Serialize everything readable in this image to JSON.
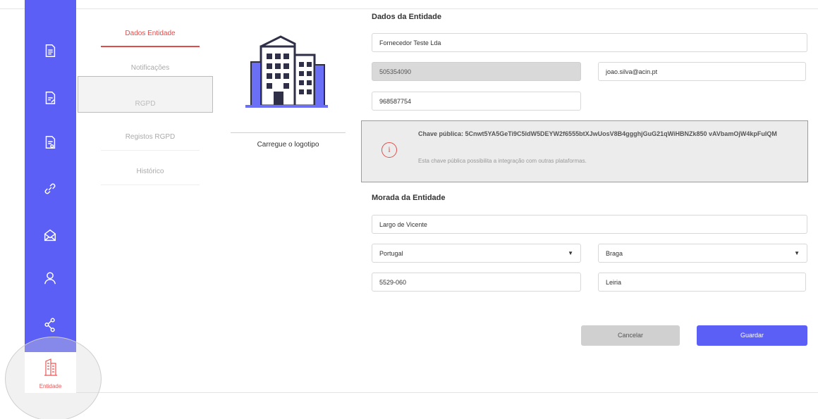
{
  "sidebar": {
    "icons": [
      "document-icon",
      "document-edit-icon",
      "document-check-icon",
      "link-icon",
      "mail-icon",
      "user-icon",
      "share-icon"
    ],
    "active_label": "Entidade",
    "active_icon": "building-icon"
  },
  "tabs": [
    "Dados Entidade",
    "Notificações",
    "RGPD",
    "Registos RGPD",
    "Histórico"
  ],
  "logo": {
    "caption": "Carregue o logotipo"
  },
  "entity": {
    "title": "Dados da Entidade",
    "name": "Fornecedor Teste Lda",
    "nif": "505354090",
    "email": "joao.silva@acin.pt",
    "phone": "968587754"
  },
  "key_info": {
    "key_text": "Chave pública: 5Cnwt5YA5GeTi9C5ldW5DEYW2f6555btXJwUosV8B4ggghjGuG21qWiHBNZk850 vAVbamOjW4kpFuIQM",
    "description": "Esta chave pública possibilita a integração com outras plataformas."
  },
  "address": {
    "title": "Morada da Entidade",
    "street": "Largo de Vicente",
    "country": "Portugal",
    "district": "Braga",
    "postal_code": "5529-060",
    "city": "Leiria"
  },
  "buttons": {
    "cancel": "Cancelar",
    "save": "Guardar"
  },
  "colors": {
    "primary": "#5b5ff5",
    "accent": "#e24b4b"
  }
}
